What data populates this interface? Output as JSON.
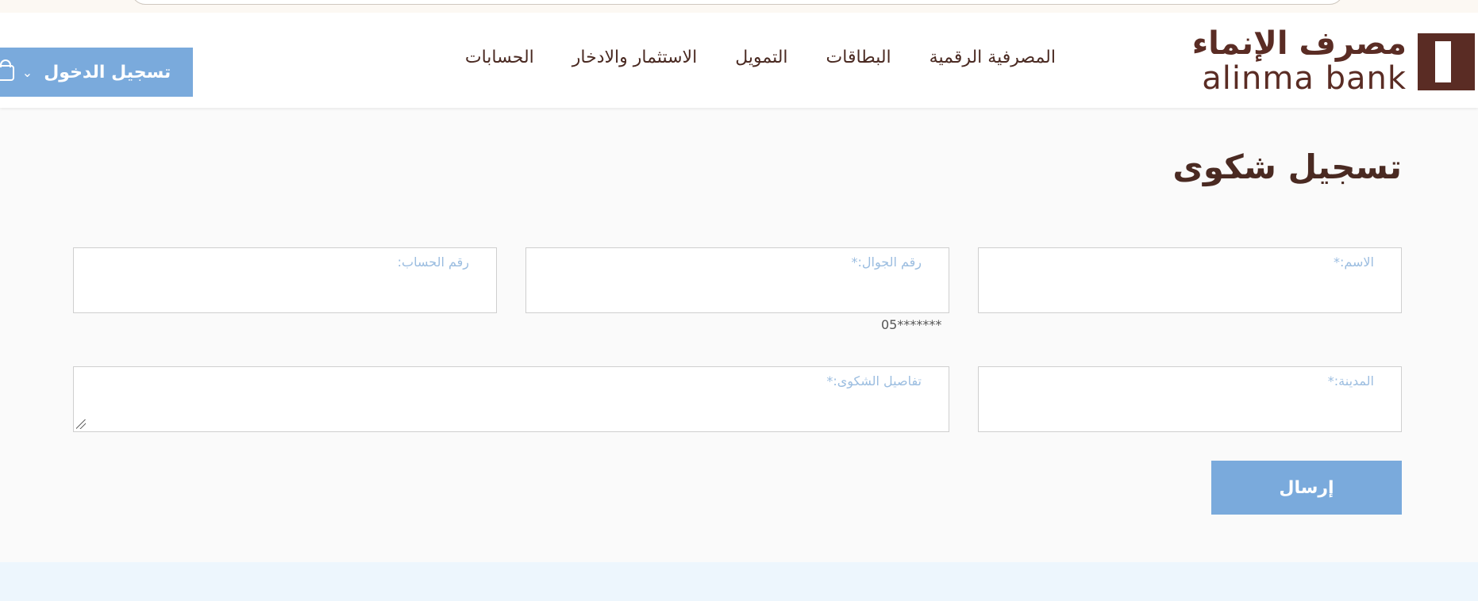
{
  "brand": {
    "name_ar": "مصرف الإنماء",
    "name_en": "alinma bank",
    "color": "#5a2c24"
  },
  "nav": {
    "items": [
      {
        "label": "المصرفية الرقمية"
      },
      {
        "label": "البطاقات"
      },
      {
        "label": "التمويل"
      },
      {
        "label": "الاستثمار والادخار"
      },
      {
        "label": "الحسابات"
      }
    ]
  },
  "login": {
    "label": "تسجيل الدخول",
    "icon": "lock-icon",
    "chevron_icon": "chevron-down-icon",
    "color": "#7aaadc"
  },
  "form": {
    "title": "تسجيل شكوى",
    "fields": {
      "name": {
        "label": "الاسم:*",
        "value": ""
      },
      "mobile": {
        "label": "رقم الجوال:*",
        "value": "",
        "hint": "05*******"
      },
      "account": {
        "label": "رقم الحساب:",
        "value": ""
      },
      "city": {
        "label": "المدينة:*",
        "value": ""
      },
      "details": {
        "label": "تفاصيل الشكوى:*",
        "value": ""
      }
    },
    "submit_label": "إرسال"
  }
}
